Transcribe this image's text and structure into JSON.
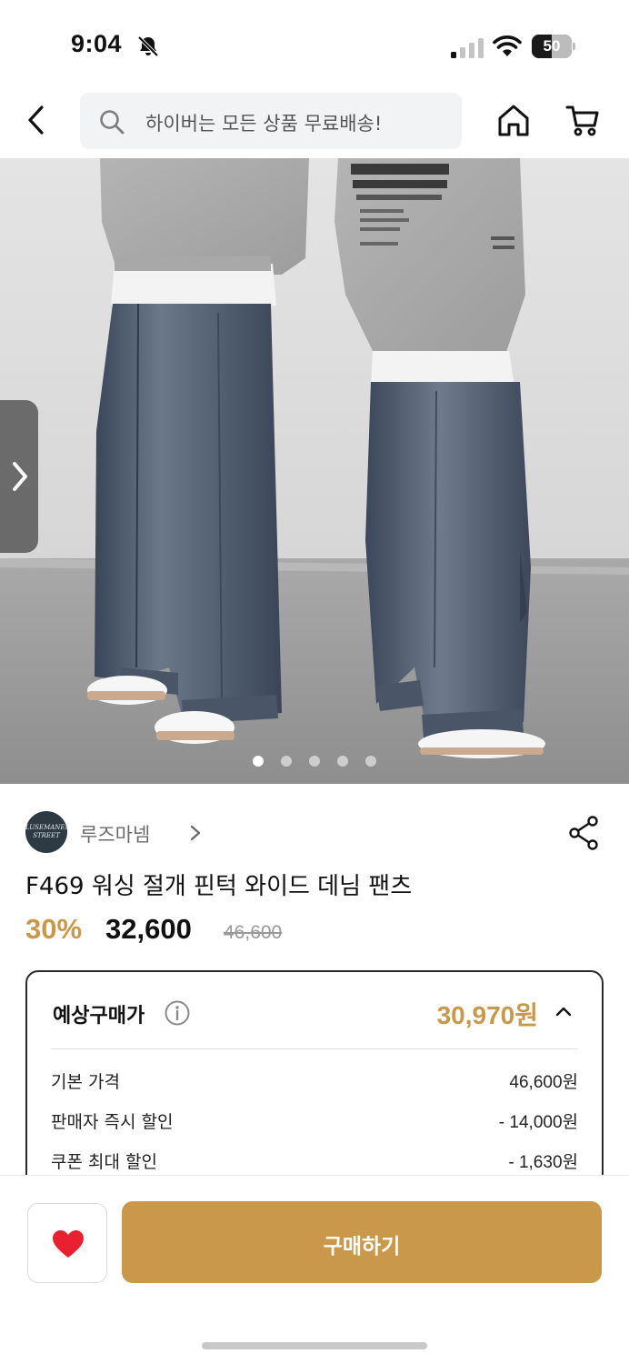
{
  "status_bar": {
    "time": "9:04",
    "battery": "50",
    "battery_level": 0.5
  },
  "header": {
    "search_placeholder": "하이버는 모든 상품 무료배송!"
  },
  "gallery": {
    "image_count": 5,
    "active_index": 0
  },
  "seller": {
    "name": "루즈마넴",
    "logo_text": "LUSEMANEM STREET"
  },
  "product": {
    "title": "F469 워싱 절개 핀턱 와이드 데님 팬츠",
    "discount": "30%",
    "price": "32,600",
    "original_price": "46,600"
  },
  "estimate": {
    "label": "예상구매가",
    "value": "30,970원",
    "rows": [
      {
        "label": "기본 가격",
        "value": "46,600원"
      },
      {
        "label": "판매자 즉시 할인",
        "value": "- 14,000원"
      },
      {
        "label": "쿠폰 최대 할인",
        "value": "- 1,630원"
      }
    ]
  },
  "bottom": {
    "buy_label": "구매하기"
  },
  "colors": {
    "accent": "#c9984a",
    "heart": "#e8202f",
    "text": "#111111"
  }
}
